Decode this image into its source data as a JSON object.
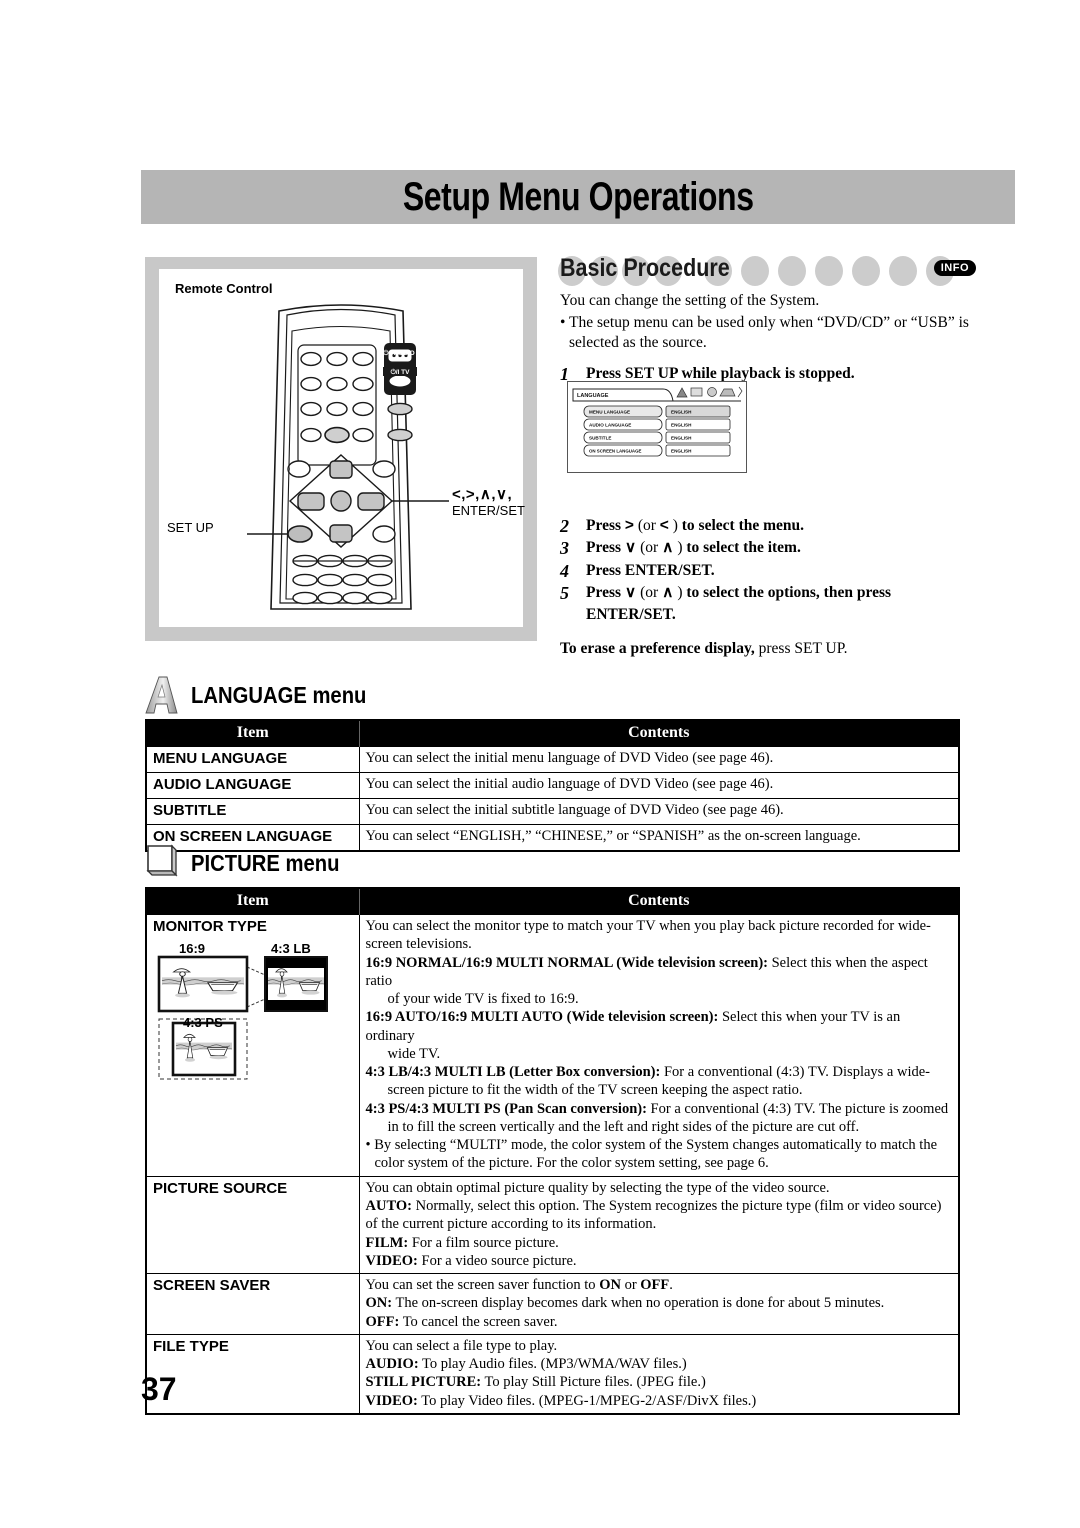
{
  "page": {
    "title": "Setup Menu Operations",
    "number": "37"
  },
  "remote": {
    "panel_label": "Remote Control",
    "callout_setup": "SET UP",
    "callout_cursor_line1": "<,>,∧,∨,",
    "callout_cursor_line2": "ENTER/SET",
    "btn_audio_label": "⏻/I AUDIO",
    "btn_tv_label": "⏻/I TV"
  },
  "basic_procedure": {
    "heading": "Basic Procedure",
    "info_badge": "INFO",
    "intro": "You can change the setting of the System.",
    "bullet": "• The setup menu can be used only when “DVD/CD” or “USB” is selected as the source.",
    "steps": [
      {
        "num": "1",
        "text": "Press SET UP while playback is stopped."
      },
      {
        "num": "2",
        "text_parts": [
          "Press ",
          ">",
          " (or ",
          "<",
          ") to select the menu."
        ]
      },
      {
        "num": "3",
        "text_parts": [
          "Press ",
          "∨",
          " (or ",
          "∧",
          " ) to select the item."
        ]
      },
      {
        "num": "4",
        "text": "Press ENTER/SET."
      },
      {
        "num": "5",
        "text_parts": [
          "Press ",
          "∨",
          " (or ",
          "∧",
          " ) to select the options, then press ENTER/SET."
        ]
      }
    ],
    "erase_bold": "To erase a preference display,",
    "erase_rest": " press SET UP."
  },
  "osd": {
    "tab_label": "LANGUAGE",
    "rows": [
      {
        "item": "MENU LANGUAGE",
        "value": "ENGLISH"
      },
      {
        "item": "AUDIO LANGUAGE",
        "value": "ENGLISH"
      },
      {
        "item": "SUBTITLE",
        "value": "ENGLISH"
      },
      {
        "item": "ON SCREEN LANGUAGE",
        "value": "ENGLISH"
      }
    ]
  },
  "language_section": {
    "heading": "LANGUAGE menu",
    "icon": "letter-a-icon",
    "col_item": "Item",
    "col_contents": "Contents",
    "rows": [
      {
        "item": "MENU LANGUAGE",
        "lines": [
          {
            "text": "You can select the initial menu language of DVD Video (see page 46)."
          }
        ]
      },
      {
        "item": "AUDIO LANGUAGE",
        "lines": [
          {
            "text": "You can select the initial audio language of DVD Video (see page 46)."
          }
        ]
      },
      {
        "item": "SUBTITLE",
        "lines": [
          {
            "text": "You can select the initial subtitle language of DVD Video (see page 46)."
          }
        ]
      },
      {
        "item": "ON SCREEN LANGUAGE",
        "lines": [
          {
            "text": "You can select “ENGLISH,” “CHINESE,” or “SPANISH” as the on-screen language."
          }
        ]
      }
    ]
  },
  "picture_section": {
    "heading": "PICTURE menu",
    "icon": "screen-icon",
    "col_item": "Item",
    "col_contents": "Contents",
    "figure": {
      "cap_169": "16:9",
      "cap_43lb": "4:3 LB",
      "cap_43ps": "4:3 PS"
    },
    "rows": [
      {
        "item": "MONITOR TYPE",
        "lines": [
          {
            "text": "You can select the monitor type to match your TV when you play back picture recorded for wide-screen televisions."
          },
          {
            "bold": "16:9 NORMAL/16:9 MULTI NORMAL (Wide television screen):",
            "text": " Select this when the aspect ratio"
          },
          {
            "indent": true,
            "text": "of your wide TV is fixed to 16:9."
          },
          {
            "bold": "16:9 AUTO/16:9 MULTI AUTO (Wide television screen):",
            "text": " Select this when your TV is an ordinary"
          },
          {
            "indent": true,
            "text": "wide TV."
          },
          {
            "bold": "4:3 LB/4:3 MULTI LB (Letter Box conversion):",
            "text": " For a conventional (4:3) TV. Displays a wide-"
          },
          {
            "indent": true,
            "text": "screen picture to fit the width of the TV screen keeping the aspect ratio."
          },
          {
            "bold": "4:3 PS/4:3 MULTI PS (Pan Scan conversion):",
            "text": " For a conventional (4:3) TV. The picture is zoomed"
          },
          {
            "indent": true,
            "text": "in to fill the screen vertically and the left and right sides of the picture are cut off."
          },
          {
            "bullet": true,
            "text": "• By selecting “MULTI” mode, the color system of the System changes automatically to match the color system of the picture. For the color system setting, see page 6."
          }
        ]
      },
      {
        "item": "PICTURE SOURCE",
        "lines": [
          {
            "text": "You can obtain optimal picture quality by selecting the type of the video source."
          },
          {
            "bold": "AUTO:",
            "text": " Normally, select this option. The System recognizes the picture type (film or video source) of the current picture according to its information."
          },
          {
            "bold": "FILM:",
            "text": " For a film source picture."
          },
          {
            "bold": "VIDEO:",
            "text": " For a video source picture."
          }
        ]
      },
      {
        "item": "SCREEN SAVER",
        "lines": [
          {
            "text_html": "You can set the screen saver function to <b>ON</b> or <b>OFF</b>."
          },
          {
            "bold": "ON:",
            "text": " The on-screen display becomes dark when no operation is done for about 5 minutes."
          },
          {
            "bold": "OFF:",
            "text": " To cancel the screen saver."
          }
        ]
      },
      {
        "item": "FILE TYPE",
        "lines": [
          {
            "text": "You can select a file type to play."
          },
          {
            "bold": "AUDIO:",
            "text": " To play Audio files. (MP3/WMA/WAV files.)"
          },
          {
            "bold": "STILL PICTURE:",
            "text": " To play Still Picture files. (JPEG file.)"
          },
          {
            "bold": "VIDEO:",
            "text": " To play Video files. (MPEG-1/MPEG-2/ASF/DivX files.)"
          }
        ]
      }
    ]
  },
  "colors": {
    "header_bar": "#b5b5b5",
    "panel_frame": "#c8c8c8",
    "table_header": "#000000",
    "circle_gray": "#cccccc"
  }
}
